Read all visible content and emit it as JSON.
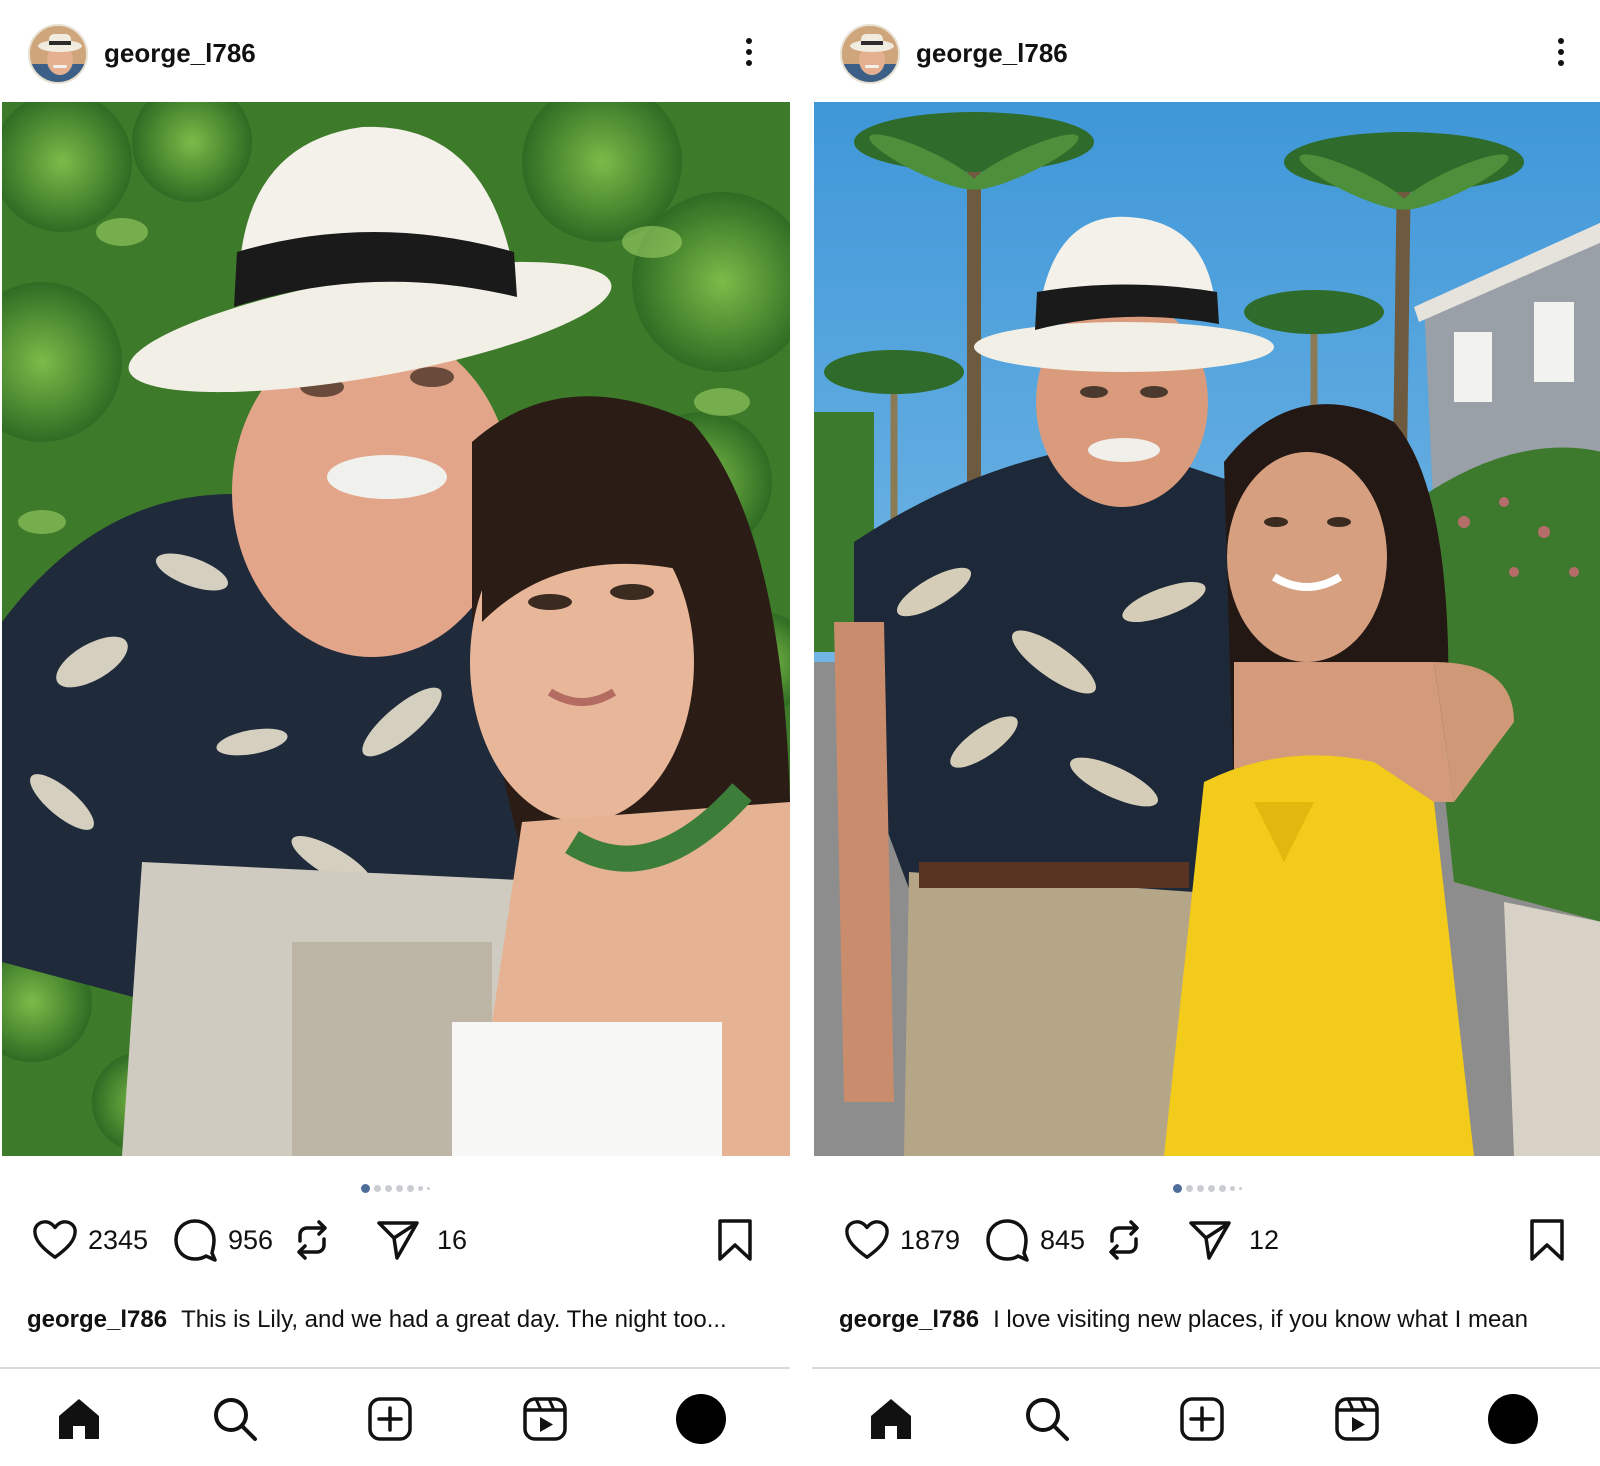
{
  "posts": [
    {
      "username": "george_l786",
      "likes": "2345",
      "comments": "956",
      "shares": "16",
      "caption_user": "george_l786",
      "caption_text": "This is Lily, and we had a great day. The night too...",
      "photo_scene": "garden"
    },
    {
      "username": "george_l786",
      "likes": "1879",
      "comments": "845",
      "shares": "12",
      "caption_user": "george_l786",
      "caption_text": "I love visiting new places, if you know what I mean",
      "photo_scene": "palm-street"
    }
  ],
  "icons": {
    "more": "more-vertical-icon",
    "like": "heart-icon",
    "comment": "comment-icon",
    "repost": "repost-icon",
    "share": "send-icon",
    "save": "bookmark-icon",
    "home": "home-icon",
    "search": "search-icon",
    "create": "add-post-icon",
    "reels": "reels-icon",
    "profile": "profile-avatar"
  },
  "colors": {
    "active_dot": "#4f6d9a",
    "inactive_dot": "#c9ccd1"
  }
}
